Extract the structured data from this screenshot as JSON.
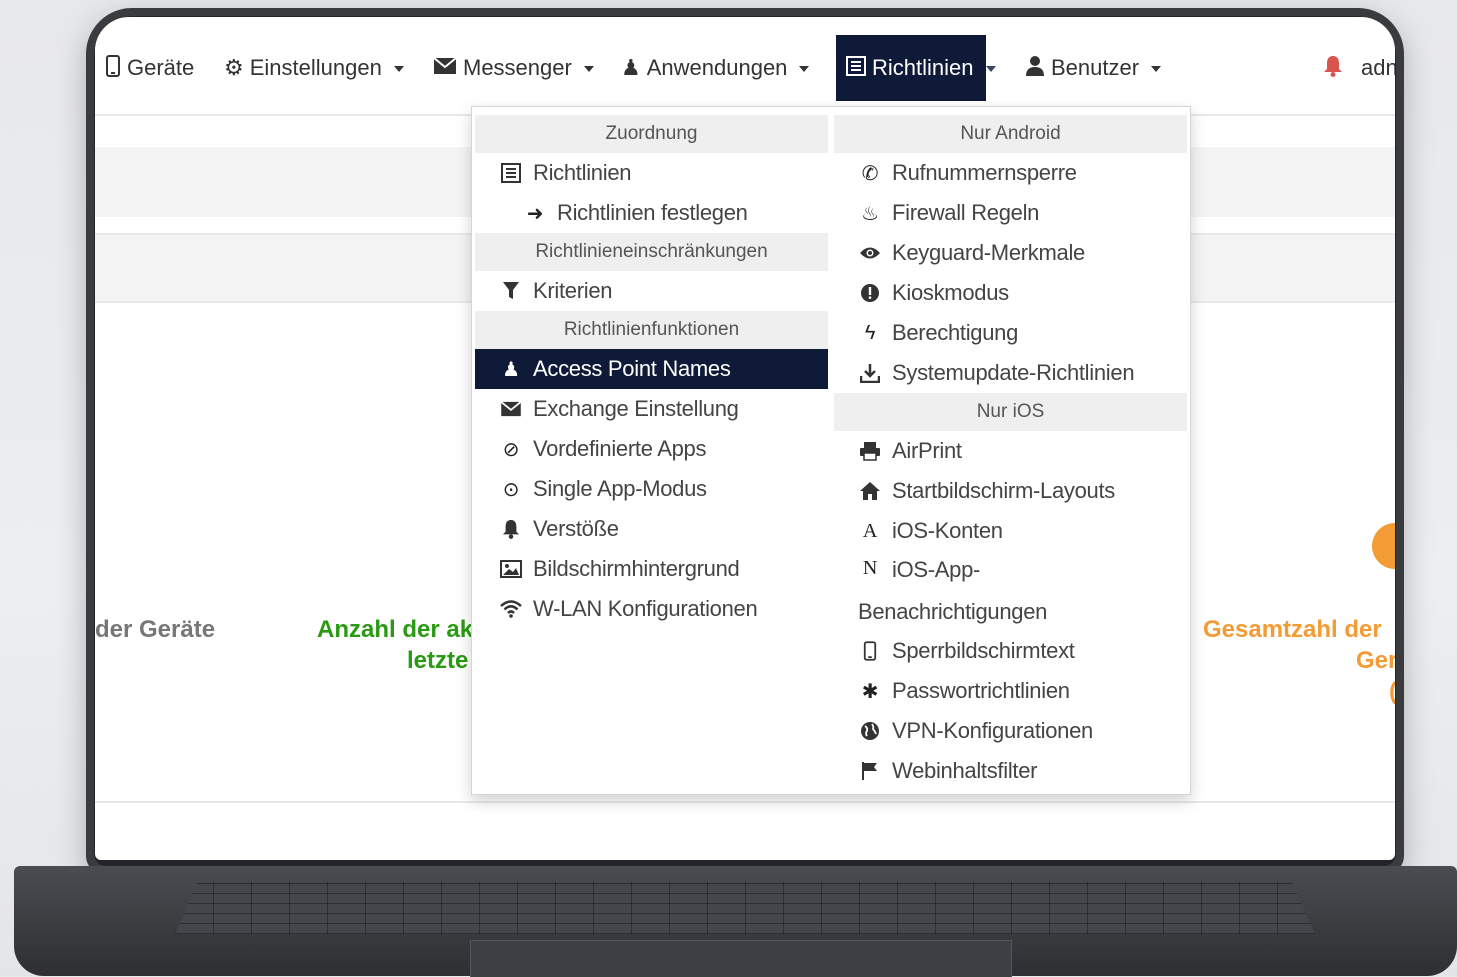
{
  "navbar": {
    "items": [
      {
        "label": "Geräte",
        "icon": "phone-icon"
      },
      {
        "label": "Einstellungen",
        "icon": "gear-icon"
      },
      {
        "label": "Messenger",
        "icon": "envelope-icon"
      },
      {
        "label": "Anwendungen",
        "icon": "chess-pawn-icon"
      },
      {
        "label": "Richtlinien",
        "icon": "list-icon",
        "active": true
      },
      {
        "label": "Benutzer",
        "icon": "user-icon"
      }
    ],
    "user_label": "adn",
    "bell_icon": "bell-icon",
    "bell_color": "#d9534f",
    "active_bg": "#0e1a37"
  },
  "dashboard": {
    "stat_left": "der Geräte",
    "stat_mid_line1": "Anzahl der ak",
    "stat_mid_line2": "letzte",
    "stat_right_line1": "Gesamtzahl der",
    "stat_right_line2": "Ger",
    "stat_right_line3": "(",
    "green": "#2a9a13",
    "orange": "#f39c35"
  },
  "dropdown": {
    "left": {
      "header1": "Zuordnung",
      "richtlinien": "Richtlinien",
      "festlegen": "Richtlinien festlegen",
      "header2": "Richtlinieneinschränkungen",
      "kriterien": "Kriterien",
      "header3": "Richtlinienfunktionen",
      "apn": "Access Point Names",
      "exchange": "Exchange Einstellung",
      "vordef": "Vordefinierte Apps",
      "single": "Single App-Modus",
      "verstoesse": "Verstöße",
      "bild": "Bildschirmhintergrund",
      "wlan": "W-LAN Konfigurationen"
    },
    "right": {
      "header1": "Nur Android",
      "rufnummer": "Rufnummernsperre",
      "firewall": "Firewall Regeln",
      "keyguard": "Keyguard-Merkmale",
      "kiosk": "Kioskmodus",
      "berechtigung": "Berechtigung",
      "systemupdate": "Systemupdate-Richtlinien",
      "header2": "Nur iOS",
      "airprint": "AirPrint",
      "startbild": "Startbildschirm-Layouts",
      "ioskonten": "iOS-Konten",
      "iosapp_line1": "iOS-App-",
      "iosapp_line2": "Benachrichtigungen",
      "sperrbild": "Sperrbildschirmtext",
      "passwort": "Passwortrichtlinien",
      "vpn": "VPN-Konfigurationen",
      "webfilter": "Webinhaltsfilter"
    }
  }
}
